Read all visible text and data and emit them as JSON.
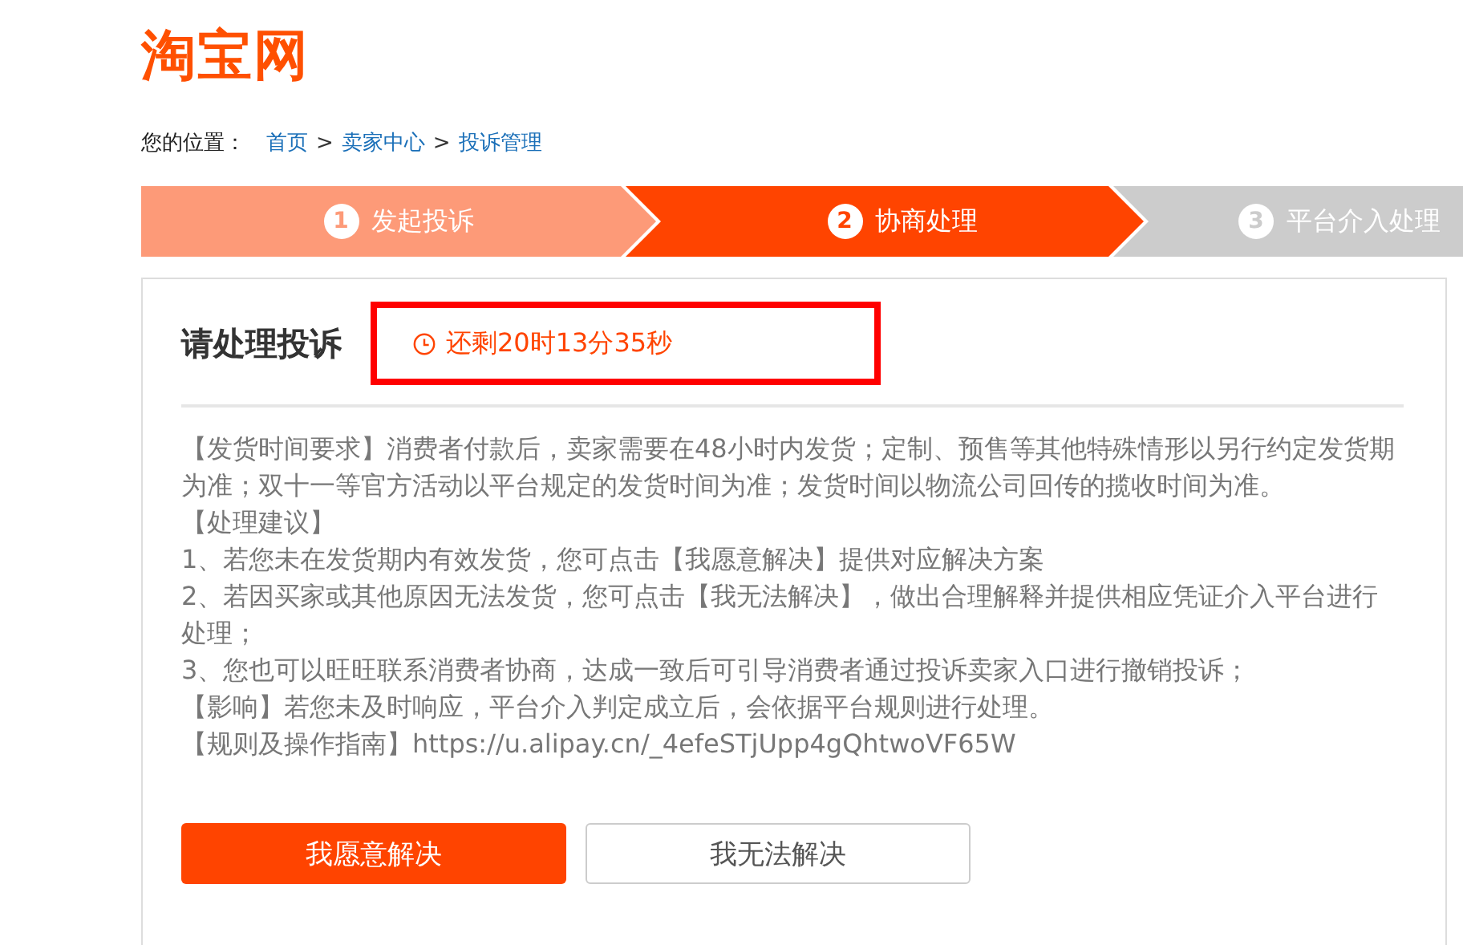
{
  "logo": {
    "text": "淘宝网"
  },
  "breadcrumb": {
    "label": "您的位置：",
    "links": [
      "首页",
      "卖家中心",
      "投诉管理"
    ],
    "separator": ">"
  },
  "steps": [
    {
      "number": "1",
      "label": "发起投诉",
      "kind": "done"
    },
    {
      "number": "2",
      "label": "协商处理",
      "kind": "current"
    },
    {
      "number": "3",
      "label": "平台介入处理",
      "kind": "pending"
    }
  ],
  "panel": {
    "title": "请处理投诉",
    "countdown": "还剩20时13分35秒",
    "paragraphs": [
      "【发货时间要求】消费者付款后，卖家需要在48小时内发货；定制、预售等其他特殊情形以另行约定发货期为准；双十一等官方活动以平台规定的发货时间为准；发货时间以物流公司回传的揽收时间为准。",
      "【处理建议】",
      "1、若您未在发货期内有效发货，您可点击【我愿意解决】提供对应解决方案",
      "2、若因买家或其他原因无法发货，您可点击【我无法解决】，做出合理解释并提供相应凭证介入平台进行处理；",
      "3、您也可以旺旺联系消费者协商，达成一致后可引导消费者通过投诉卖家入口进行撤销投诉；",
      "【影响】若您未及时响应，平台介入判定成立后，会依据平台规则进行处理。",
      "【规则及操作指南】https://u.alipay.cn/_4efeSTjUpp4gQhtwoVF65W"
    ],
    "buttons": [
      {
        "label": "我愿意解决",
        "kind": "primary"
      },
      {
        "label": "我无法解决",
        "kind": "secondary"
      }
    ]
  }
}
